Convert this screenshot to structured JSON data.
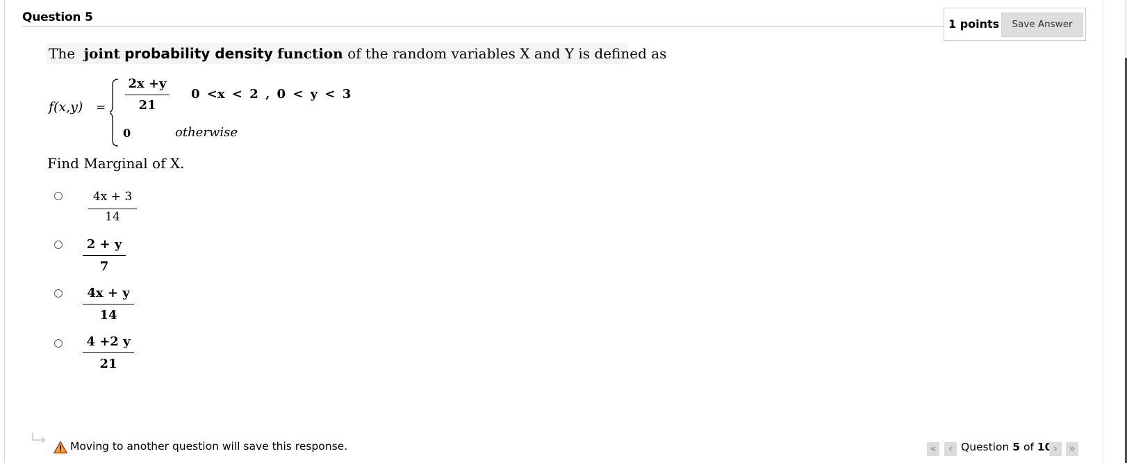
{
  "question": {
    "title": "Question 5",
    "points": "1 points",
    "save_label": "Save Answer"
  },
  "prompt": {
    "lead": "The",
    "bold1": "joint",
    "bold2": "probability density",
    "bold3": "function",
    "tail": "of the random variables X and Y is defined as"
  },
  "formula": {
    "lhs": "f(x,y)",
    "equals": "=",
    "case1_num": "2x +y",
    "case1_den": "21",
    "case1_cond": "0 <x < 2 ,  0 < y < 3",
    "case2_val": "0",
    "case2_cond": "otherwise"
  },
  "instruction": "Find Marginal of X.",
  "options": [
    {
      "num": "4x + 3",
      "den": "14"
    },
    {
      "num": "2 + y",
      "den": "7"
    },
    {
      "num": "4x + y",
      "den": "14"
    },
    {
      "num": "4 +2 y",
      "den": "21"
    }
  ],
  "footer": {
    "note": "Moving to another question will save this response.",
    "nav_prefix": "Question",
    "current": "5",
    "of": "of",
    "total": "10"
  },
  "icons": {
    "warning": "warning-icon",
    "arrow": "return-arrow-icon",
    "first": "«",
    "prev": "‹",
    "next": "›",
    "last": "»"
  },
  "colors": {
    "warning_fill": "#f5a623",
    "warning_border": "#c0392b",
    "button_bg": "#dedede"
  }
}
